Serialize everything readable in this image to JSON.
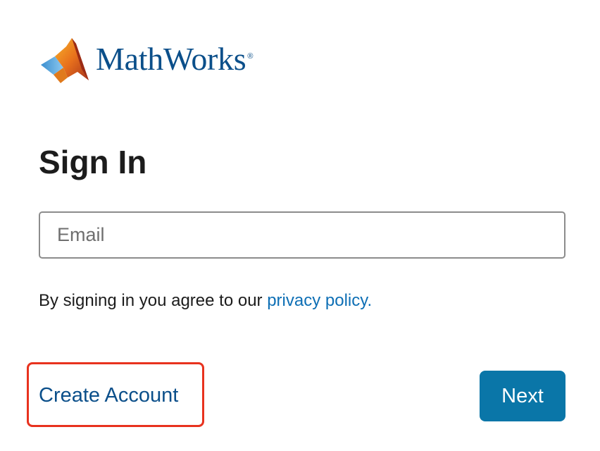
{
  "brand": {
    "name": "MathWorks",
    "registered_mark": "®",
    "logo_icon": "matlab-membrane-logo",
    "color": "#0b4f8a"
  },
  "form": {
    "title": "Sign In",
    "email": {
      "value": "",
      "placeholder": "Email"
    },
    "consent": {
      "text": "By signing in you agree to our ",
      "link_label": "privacy policy."
    },
    "create_account_label": "Create Account",
    "next_label": "Next"
  },
  "colors": {
    "link": "#0e6fb5",
    "primary_button": "#0a76a8",
    "highlight": "#e8321e"
  }
}
